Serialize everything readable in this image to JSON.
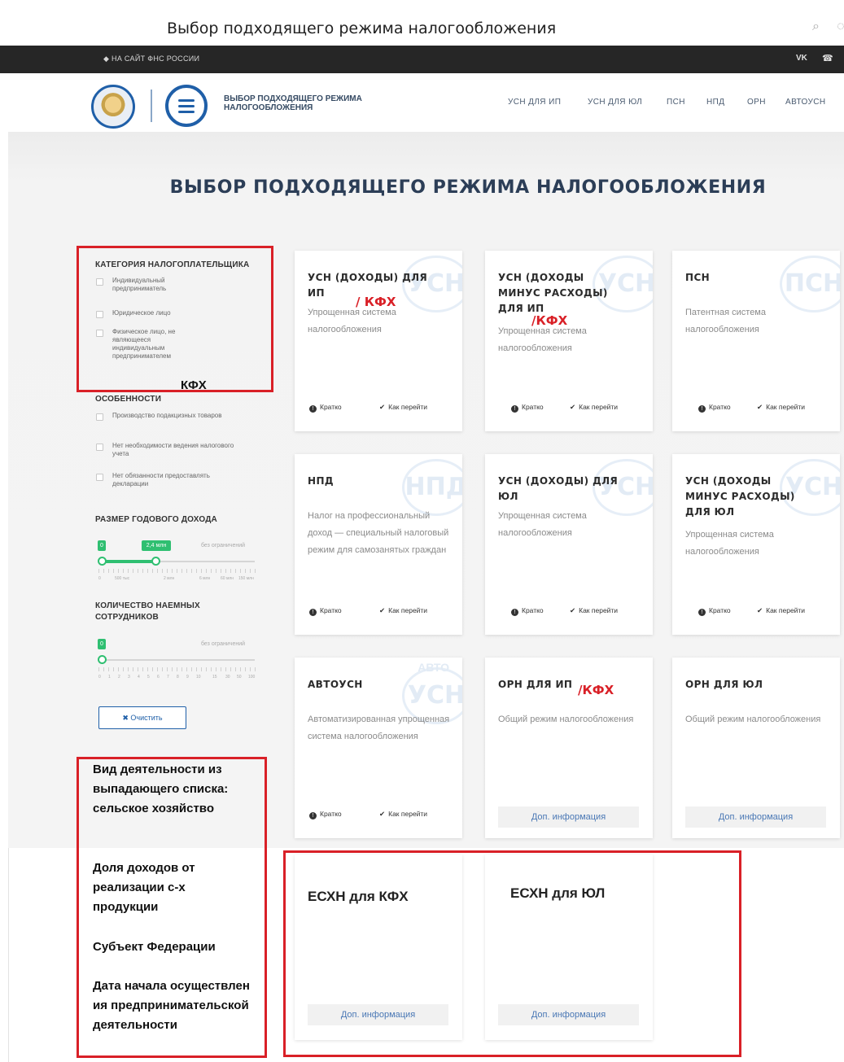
{
  "browser": {
    "title": "Выбор подходящего режима налогообложения"
  },
  "topbar": {
    "link": "НА САЙТ ФНС РОССИИ",
    "vk": "VK",
    "phone": "☎"
  },
  "header": {
    "logo_title": "ВЫБОР ПОДХОДЯЩЕГО РЕЖИМА НАЛОГООБЛОЖЕНИЯ",
    "nav": [
      "УСН ДЛЯ ИП",
      "УСН ДЛЯ ЮЛ",
      "ПСН",
      "НПД",
      "ОРН",
      "АВТОУСН"
    ]
  },
  "page_title": "ВЫБОР ПОДХОДЯЩЕГО РЕЖИМА НАЛОГООБЛОЖЕНИЯ",
  "filters": {
    "category": {
      "heading": "КАТЕГОРИЯ НАЛОГОПЛАТЕЛЬЩИКА",
      "options": [
        "Индивидуальный предприниматель",
        "Юридическое лицо",
        "Физическое лицо, не являющееся индивидуальным предпринимателем"
      ]
    },
    "features": {
      "heading": "ОСОБЕННОСТИ",
      "options": [
        "Производство подакцизных товаров",
        "Нет необходимости ведения налогового учета",
        "Нет обязанности предоставлять декларации"
      ]
    },
    "income": {
      "heading": "РАЗМЕР ГОДОВОГО ДОХОДА",
      "min_badge": "0",
      "value_badge": "2,4 млн",
      "unlimited": "без ограничений",
      "tick_labels": [
        "0",
        "500 тыс",
        "2 млн",
        "6 млн",
        "60 млн",
        "150 млн"
      ]
    },
    "employees": {
      "heading": "КОЛИЧЕСТВО НАЕМНЫХ СОТРУДНИКОВ",
      "min_badge": "0",
      "unlimited": "без ограничений",
      "tick_labels": [
        "0",
        "1",
        "2",
        "3",
        "4",
        "5",
        "6",
        "7",
        "8",
        "9",
        "10",
        "15",
        "30",
        "50",
        "100"
      ]
    },
    "clear": "✖ Очистить"
  },
  "cards": [
    {
      "title": "УСН (ДОХОДЫ) ДЛЯ ИП",
      "watermark": "УСН",
      "desc": "Упрощенная система налогообложения",
      "brief": "Кратко",
      "how": "Как перейти"
    },
    {
      "title": "УСН (ДОХОДЫ МИНУС РАСХОДЫ) ДЛЯ ИП",
      "watermark": "УСН",
      "desc": "Упрощенная система налогообложения",
      "brief": "Кратко",
      "how": "Как перейти"
    },
    {
      "title": "ПСН",
      "watermark": "ПСН",
      "desc": "Патентная система налогообложения",
      "brief": "Кратко",
      "how": "Как перейти"
    },
    {
      "title": "НПД",
      "watermark": "НПД",
      "desc": "Налог на профессиональный доход — специальный налоговый режим для самозанятых граждан",
      "brief": "Кратко",
      "how": "Как перейти"
    },
    {
      "title": "УСН (ДОХОДЫ) ДЛЯ ЮЛ",
      "watermark": "УСН",
      "desc": "Упрощенная система налогообложения",
      "brief": "Кратко",
      "how": "Как перейти"
    },
    {
      "title": "УСН (ДОХОДЫ МИНУС РАСХОДЫ) ДЛЯ ЮЛ",
      "watermark": "УСН",
      "desc": "Упрощенная система налогообложения",
      "brief": "Кратко",
      "how": "Как перейти"
    },
    {
      "title": "АВТОУСН",
      "watermark": "УСН",
      "watermark_top": "АВТО",
      "desc": "Автоматизированная упрощенная система налогообложения",
      "brief": "Кратко",
      "how": "Как перейти"
    },
    {
      "title": "ОРН ДЛЯ ИП",
      "desc": "Общий режим налогообложения",
      "more": "Доп. информация"
    },
    {
      "title": "ОРН ДЛЯ ЮЛ",
      "desc": "Общий режим налогообложения",
      "more": "Доп. информация"
    },
    {
      "title": "ЕСХН для КФХ",
      "more": "Доп. информация"
    },
    {
      "title": "ЕСХН для ЮЛ",
      "more": "Доп. информация"
    }
  ],
  "annotations": {
    "kfh_card1": "/ КФХ",
    "kfh_card2": "/КФХ",
    "kfh_card8": "/КФХ",
    "kfh_filter": "КФХ",
    "list": [
      "Вид деятельности из выпадающего списка: сельское хозяйство",
      "Доля доходов от реализации с-х продукции",
      "Субъект Федерации",
      "Дата начала осуществления предпринимательской деятельности"
    ],
    "color": "#d92027"
  },
  "colors": {
    "accent": "#1f5fa8",
    "slider": "#2fbf71",
    "topbar": "#262626",
    "annotation": "#d92027"
  }
}
